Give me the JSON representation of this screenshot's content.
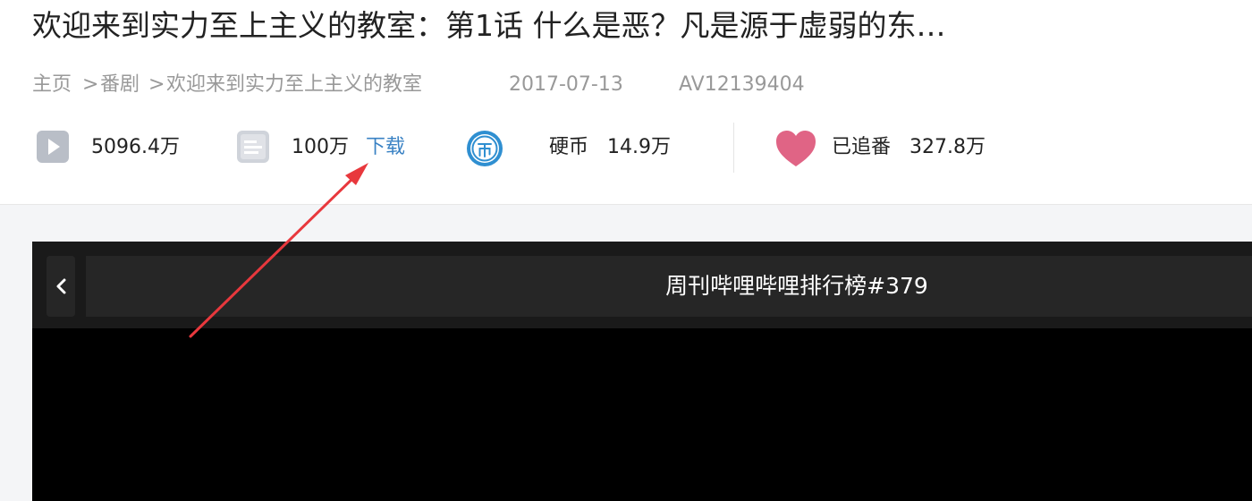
{
  "video": {
    "title": "欢迎来到实力至上主义的教室：第1话 什么是恶？凡是源于虚弱的东…"
  },
  "breadcrumb": {
    "items": [
      "主页",
      "番剧",
      "欢迎来到实力至上主义的教室"
    ],
    "separator": ">"
  },
  "meta": {
    "date": "2017-07-13",
    "av_id": "AV12139404"
  },
  "stats": {
    "plays": "5096.4万",
    "danmaku": "100万",
    "download_label": "下载",
    "coin_label": "硬币",
    "coins": "14.9万",
    "follow_label": "已追番",
    "follows": "327.8万"
  },
  "player": {
    "playlist_title": "周刊哔哩哔哩排行榜#379"
  },
  "colors": {
    "accent_link": "#3a82c4",
    "heart": "#e06485",
    "coin": "#2f8fd1",
    "annotation_arrow": "#e8383d"
  },
  "icons": {
    "plays": "play-icon",
    "danmaku": "danmaku-icon",
    "coin": "coin-icon",
    "follow": "heart-icon",
    "back": "chevron-left-icon"
  }
}
